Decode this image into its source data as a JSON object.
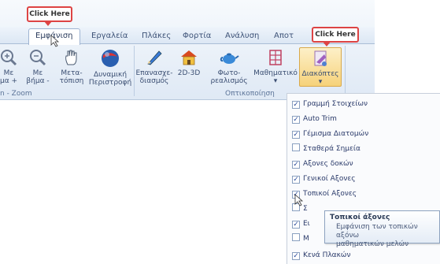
{
  "tabs": [
    {
      "label": "Εμφάνιση"
    },
    {
      "label": "Εργαλεία"
    },
    {
      "label": "Πλάκες"
    },
    {
      "label": "Φορτία"
    },
    {
      "label": "Ανάλυση"
    },
    {
      "label": "Αποτ"
    }
  ],
  "ribbon": {
    "buttons": [
      {
        "label1": "Με",
        "label2": "μα +"
      },
      {
        "label1": "Με",
        "label2": "βήμα -"
      },
      {
        "label1": "Μετα-",
        "label2": "τόπιση"
      },
      {
        "label1": "Δυναμική",
        "label2": "Περιστροφή"
      },
      {
        "label1": "Επανασχε-",
        "label2": "διασμός"
      },
      {
        "label1": "2D-3D",
        "label2": ""
      },
      {
        "label1": "Φωτο-",
        "label2": "ρεαλισμός"
      },
      {
        "label1": "Μαθηματικό",
        "label2": "▾"
      },
      {
        "label1": "Διακόπτες",
        "label2": "▾"
      }
    ],
    "groups": {
      "zoom": "n - Zoom",
      "visual": "Οπτικοποίηση"
    }
  },
  "callouts": {
    "top": "Click Here",
    "right": "Click Here"
  },
  "dropdown": {
    "items": [
      {
        "label": "Γραμμή Στοιχείων",
        "checked": true
      },
      {
        "label": "Auto Trim",
        "checked": true
      },
      {
        "label": "Γέμισμα Διατομών",
        "checked": true
      },
      {
        "label": "Σταθερά Σημεία",
        "checked": false
      },
      {
        "label": "Αξονες δοκών",
        "checked": true
      },
      {
        "label": "Γενικοί Αξονες",
        "checked": true
      },
      {
        "label": "Τοπικοί Αξονες",
        "checked": true
      },
      {
        "label": "Σ",
        "checked": false
      },
      {
        "label": "Ει",
        "checked": true
      },
      {
        "label": "Μ",
        "checked": false
      },
      {
        "label": "Κενά Πλακών",
        "checked": true
      }
    ]
  },
  "tooltip": {
    "title": "Τοπικοί άξονες",
    "body_line1": "Εμφάνιση των τοπικών αξόνω",
    "body_line2": "μαθηματικών μελών"
  }
}
